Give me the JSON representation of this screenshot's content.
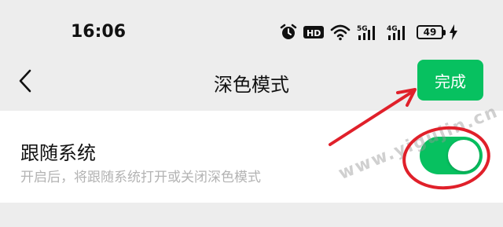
{
  "status_bar": {
    "time": "16:06",
    "hd_label": "HD",
    "net1_label": "5G",
    "net2_label": "4G",
    "battery_level": "49",
    "icons": [
      "alarm-icon",
      "hd-icon",
      "wifi-icon",
      "signal-5g-icon",
      "signal-4g-icon",
      "battery-icon",
      "charging-icon"
    ]
  },
  "nav": {
    "title": "深色模式",
    "done_label": "完成",
    "back_icon": "chevron-left-icon"
  },
  "setting": {
    "title": "跟随系统",
    "description": "开启后，将跟随系统打开或关闭深色模式",
    "enabled": true
  },
  "watermark": "www.yigujin.cn",
  "colors": {
    "accent": "#07c160",
    "background": "#ededed",
    "card": "#ffffff",
    "annotation": "#e0202a"
  }
}
